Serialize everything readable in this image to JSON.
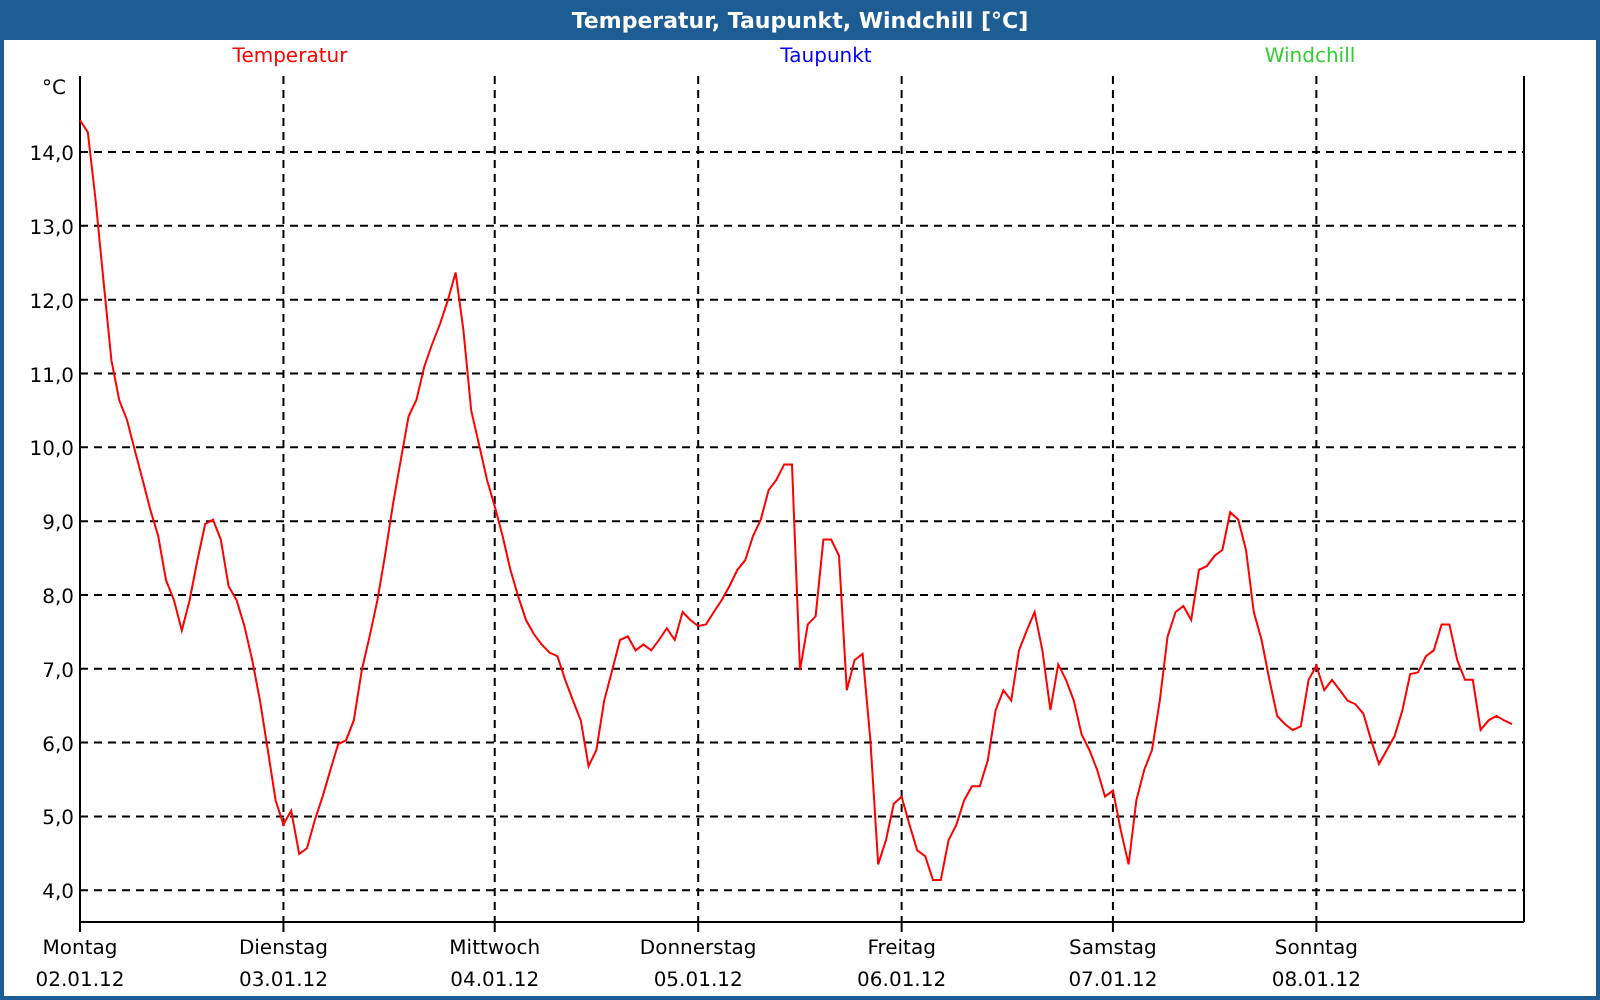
{
  "window": {
    "title": "Temperatur, Taupunkt, Windchill [°C]"
  },
  "legend": [
    {
      "label": "Taupunkt",
      "color": "#0000ff"
    },
    {
      "label": "Windchill",
      "color": "#33cc33"
    }
  ],
  "chart": {
    "unit": "°C",
    "dates": [
      "02.01.12",
      "03.01.12",
      "04.01.12",
      "05.01.12",
      "06.01.12",
      "07.01.12",
      "08.01.12"
    ],
    "chart_data": {
      "type": "line",
      "grid": true,
      "categories": [
        "Montag",
        null,
        null,
        null,
        null,
        null,
        null,
        null,
        null,
        null,
        null,
        null,
        null,
        null,
        null,
        null,
        null,
        null,
        null,
        null,
        null,
        null,
        null,
        null,
        null,
        null,
        "Dienstag",
        null,
        null,
        null,
        null,
        null,
        null,
        null,
        null,
        null,
        null,
        null,
        null,
        null,
        null,
        null,
        null,
        null,
        null,
        null,
        null,
        null,
        null,
        null,
        null,
        null,
        null,
        "Mittwoch",
        null,
        null,
        null,
        null,
        null,
        null,
        null,
        null,
        null,
        null,
        null,
        null,
        null,
        null,
        null,
        null,
        null,
        null,
        null,
        null,
        null,
        null,
        null,
        null,
        null,
        "Donnerstag",
        null,
        null,
        null,
        null,
        null,
        null,
        null,
        null,
        null,
        null,
        null,
        null,
        null,
        null,
        null,
        null,
        null,
        null,
        null,
        null,
        null,
        null,
        null,
        null,
        null,
        "Freitag",
        null,
        null,
        null,
        null,
        null,
        null,
        null,
        null,
        null,
        null,
        null,
        null,
        null,
        null,
        null,
        null,
        null,
        null,
        null,
        null,
        null,
        null,
        null,
        null,
        null,
        null,
        "Samstag",
        null,
        null,
        null,
        null,
        null,
        null,
        null,
        null,
        null,
        null,
        null,
        null,
        null,
        null,
        null,
        null,
        null,
        null,
        null,
        null,
        null,
        null,
        null,
        null,
        null,
        "Sonntag",
        null,
        null,
        null,
        null,
        null,
        null,
        null,
        null,
        null,
        null,
        null,
        null,
        null,
        null,
        null,
        null,
        null,
        null,
        null,
        null,
        null,
        null,
        null,
        null,
        null
      ],
      "ylim": [
        3.57,
        15.03
      ],
      "yticks": [
        {
          "value": 4,
          "label": "4,0"
        },
        {
          "value": 5,
          "label": "5,0"
        },
        {
          "value": 6,
          "label": "6,0"
        },
        {
          "value": 7,
          "label": "7,0"
        },
        {
          "value": 8,
          "label": "8,0"
        },
        {
          "value": 9,
          "label": "9,0"
        },
        {
          "value": 10,
          "label": "10,0"
        },
        {
          "value": 11,
          "label": "11,0"
        },
        {
          "value": 12,
          "label": "12,0"
        },
        {
          "value": 13,
          "label": "13,0"
        },
        {
          "value": 14,
          "label": "14,0"
        }
      ],
      "series": [
        {
          "name": "Temperatur",
          "color": "#ff0000",
          "values": [
            14.43,
            14.27,
            13.35,
            12.27,
            11.18,
            10.64,
            10.37,
            9.96,
            9.56,
            9.15,
            8.8,
            8.2,
            7.93,
            7.52,
            7.93,
            8.47,
            8.96,
            9.02,
            8.75,
            8.12,
            7.93,
            7.58,
            7.12,
            6.57,
            5.9,
            5.22,
            4.89,
            5.08,
            4.49,
            4.57,
            4.95,
            5.27,
            5.63,
            5.98,
            6.03,
            6.3,
            6.98,
            7.44,
            7.93,
            8.55,
            9.23,
            9.83,
            10.42,
            10.64,
            11.1,
            11.4,
            11.67,
            11.99,
            12.37,
            11.59,
            10.5,
            10.04,
            9.56,
            9.2,
            8.8,
            8.34,
            7.98,
            7.66,
            7.47,
            7.33,
            7.22,
            7.17,
            6.85,
            6.57,
            6.3,
            5.68,
            5.9,
            6.57,
            6.98,
            7.39,
            7.44,
            7.25,
            7.33,
            7.25,
            7.39,
            7.55,
            7.39,
            7.77,
            7.66,
            7.58,
            7.6,
            7.77,
            7.93,
            8.12,
            8.34,
            8.47,
            8.8,
            9.02,
            9.42,
            9.56,
            9.77,
            9.77,
            6.98,
            7.6,
            7.71,
            8.75,
            8.75,
            8.53,
            6.71,
            7.12,
            7.2,
            6.03,
            4.35,
            4.68,
            5.17,
            5.27,
            4.89,
            4.54,
            4.46,
            4.14,
            4.14,
            4.68,
            4.89,
            5.22,
            5.41,
            5.41,
            5.76,
            6.44,
            6.71,
            6.57,
            7.25,
            7.52,
            7.77,
            7.25,
            6.44,
            7.06,
            6.85,
            6.57,
            6.11,
            5.9,
            5.63,
            5.27,
            5.35,
            4.81,
            4.35,
            5.22,
            5.63,
            5.9,
            6.57,
            7.44,
            7.77,
            7.85,
            7.66,
            8.34,
            8.39,
            8.53,
            8.61,
            9.12,
            9.02,
            8.61,
            7.77,
            7.39,
            6.85,
            6.36,
            6.25,
            6.17,
            6.22,
            6.85,
            7.04,
            6.71,
            6.85,
            6.71,
            6.57,
            6.52,
            6.39,
            6.03,
            5.71,
            5.9,
            6.09,
            6.44,
            6.93,
            6.95,
            7.17,
            7.25,
            7.6,
            7.6,
            7.12,
            6.85,
            6.85,
            6.17,
            6.3,
            6.36,
            6.3,
            6.25
          ]
        }
      ]
    }
  }
}
